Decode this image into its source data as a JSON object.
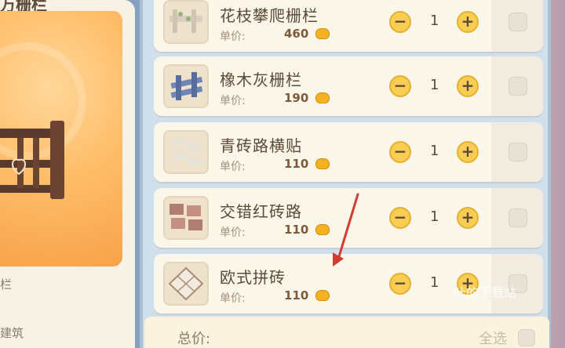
{
  "left": {
    "title": "万栅栏",
    "label_1": "栏",
    "label_2": "建筑"
  },
  "items": [
    {
      "name": "花枝攀爬栅栏",
      "unit_label": "单价:",
      "price": "460",
      "quantity": "1",
      "icon": "fence-flower-icon"
    },
    {
      "name": "橡木灰栅栏",
      "unit_label": "单价:",
      "price": "190",
      "quantity": "1",
      "icon": "fence-oak-icon"
    },
    {
      "name": "青砖路横贴",
      "unit_label": "单价:",
      "price": "110",
      "quantity": "1",
      "icon": "brick-path-icon"
    },
    {
      "name": "交错红砖路",
      "unit_label": "单价:",
      "price": "110",
      "quantity": "1",
      "icon": "red-brick-icon"
    },
    {
      "name": "欧式拼砖",
      "unit_label": "单价:",
      "price": "110",
      "quantity": "1",
      "icon": "tile-icon"
    }
  ],
  "controls": {
    "minus": "−",
    "plus": "+"
  },
  "footer": {
    "total_label": "总价:",
    "select_all": "全选"
  },
  "watermark": "叶的下载站",
  "colors": {
    "accent": "#f8cd52",
    "coin": "#f4b223",
    "arrow": "#d63a2e"
  }
}
